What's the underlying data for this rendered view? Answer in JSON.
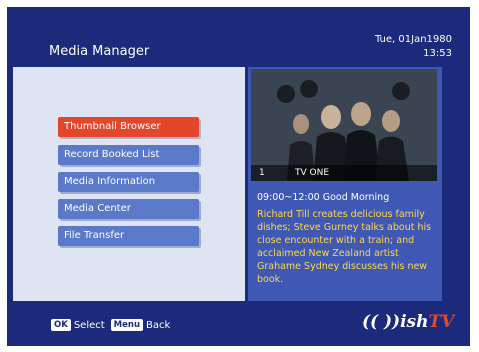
{
  "header": {
    "title": "Media Manager",
    "date": "Tue, 01Jan1980",
    "time": "13:53"
  },
  "menu": {
    "items": [
      {
        "label": "Thumbnail Browser",
        "selected": true
      },
      {
        "label": "Record Booked List",
        "selected": false
      },
      {
        "label": "Media Information",
        "selected": false
      },
      {
        "label": "Media Center",
        "selected": false
      },
      {
        "label": "File Transfer",
        "selected": false
      }
    ]
  },
  "preview": {
    "channel_number": "1",
    "channel_name": "TV ONE",
    "programme": "09:00~12:00  Good Morning",
    "description": "Richard Till creates delicious family dishes; Steve Gurney talks about his close encounter with a train; and acclaimed New Zealand artist Grahame Sydney discusses his new book."
  },
  "footer": {
    "ok_key": "OK",
    "ok_label": "Select",
    "menu_key": "Menu",
    "menu_label": "Back"
  },
  "logo": {
    "text": "(( ))ish",
    "tv": "TV"
  },
  "colors": {
    "background": "#1b2a7b",
    "menu_item": "#5a79c9",
    "menu_selected": "#e2462b",
    "info_panel": "#3f58b3",
    "description_text": "#ffd84a"
  }
}
